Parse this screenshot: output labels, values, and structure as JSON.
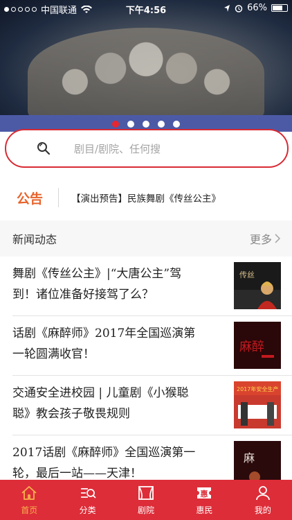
{
  "status": {
    "carrier": "中国联通",
    "time": "下午4:56",
    "battery": "66%"
  },
  "banner": {
    "slide_count": 5,
    "active_index": 0
  },
  "search": {
    "placeholder": "剧目/剧院、任何搜"
  },
  "notice": {
    "tag": "公告",
    "text": "【演出预告】民族舞剧《传丝公主》"
  },
  "news": {
    "title": "新闻动态",
    "more": "更多",
    "items": [
      {
        "line1": "舞剧《传丝公主》|“大唐公主”驾",
        "line2": "到！诸位准备好接驾了么？",
        "thumb_color": "#1a1a1a"
      },
      {
        "line1": "话剧《麻醉师》2017年全国巡演第",
        "line2": "一轮圆满收官！",
        "thumb_color": "#2a0708"
      },
      {
        "line1": "交通安全进校园 | 儿童剧《小猴聪",
        "line2": "聪》教会孩子敬畏规则",
        "thumb_color": "#c93a2e"
      },
      {
        "line1": "2017话剧《麻醉师》全国巡演第一",
        "line2": "轮，最后一站——天津！",
        "thumb_color": "#2b0a0c"
      }
    ]
  },
  "tabs": [
    {
      "label": "首页",
      "icon": "home-icon",
      "active": true
    },
    {
      "label": "分类",
      "icon": "category-icon",
      "active": false
    },
    {
      "label": "剧院",
      "icon": "theater-icon",
      "active": false
    },
    {
      "label": "惠民",
      "icon": "benefit-icon",
      "active": false
    },
    {
      "label": "我的",
      "icon": "profile-icon",
      "active": false
    }
  ],
  "colors": {
    "brand_red": "#dd2d38",
    "active_tab": "#f6b24d",
    "notice_orange": "#e8622a"
  }
}
